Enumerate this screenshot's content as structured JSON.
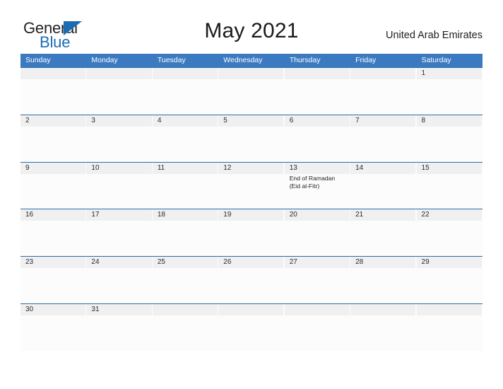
{
  "header": {
    "logo": {
      "word_one": "General",
      "word_two": "Blue",
      "triangle_color": "#1b6cb3"
    },
    "title": "May 2021",
    "country": "United Arab Emirates"
  },
  "calendar": {
    "weekdays": [
      "Sunday",
      "Monday",
      "Tuesday",
      "Wednesday",
      "Thursday",
      "Friday",
      "Saturday"
    ],
    "header_color": "#3b7ac0",
    "row_divider_color": "#2a6da8",
    "day_band_color": "#f0f0f0",
    "weeks": [
      {
        "days": [
          {
            "number": "",
            "events": []
          },
          {
            "number": "",
            "events": []
          },
          {
            "number": "",
            "events": []
          },
          {
            "number": "",
            "events": []
          },
          {
            "number": "",
            "events": []
          },
          {
            "number": "",
            "events": []
          },
          {
            "number": "1",
            "events": []
          }
        ]
      },
      {
        "days": [
          {
            "number": "2",
            "events": []
          },
          {
            "number": "3",
            "events": []
          },
          {
            "number": "4",
            "events": []
          },
          {
            "number": "5",
            "events": []
          },
          {
            "number": "6",
            "events": []
          },
          {
            "number": "7",
            "events": []
          },
          {
            "number": "8",
            "events": []
          }
        ]
      },
      {
        "days": [
          {
            "number": "9",
            "events": []
          },
          {
            "number": "10",
            "events": []
          },
          {
            "number": "11",
            "events": []
          },
          {
            "number": "12",
            "events": []
          },
          {
            "number": "13",
            "events": [
              "End of Ramadan",
              "(Eid al-Fitr)"
            ]
          },
          {
            "number": "14",
            "events": []
          },
          {
            "number": "15",
            "events": []
          }
        ]
      },
      {
        "days": [
          {
            "number": "16",
            "events": []
          },
          {
            "number": "17",
            "events": []
          },
          {
            "number": "18",
            "events": []
          },
          {
            "number": "19",
            "events": []
          },
          {
            "number": "20",
            "events": []
          },
          {
            "number": "21",
            "events": []
          },
          {
            "number": "22",
            "events": []
          }
        ]
      },
      {
        "days": [
          {
            "number": "23",
            "events": []
          },
          {
            "number": "24",
            "events": []
          },
          {
            "number": "25",
            "events": []
          },
          {
            "number": "26",
            "events": []
          },
          {
            "number": "27",
            "events": []
          },
          {
            "number": "28",
            "events": []
          },
          {
            "number": "29",
            "events": []
          }
        ]
      },
      {
        "days": [
          {
            "number": "30",
            "events": []
          },
          {
            "number": "31",
            "events": []
          },
          {
            "number": "",
            "events": []
          },
          {
            "number": "",
            "events": []
          },
          {
            "number": "",
            "events": []
          },
          {
            "number": "",
            "events": []
          },
          {
            "number": "",
            "events": []
          }
        ]
      }
    ]
  }
}
